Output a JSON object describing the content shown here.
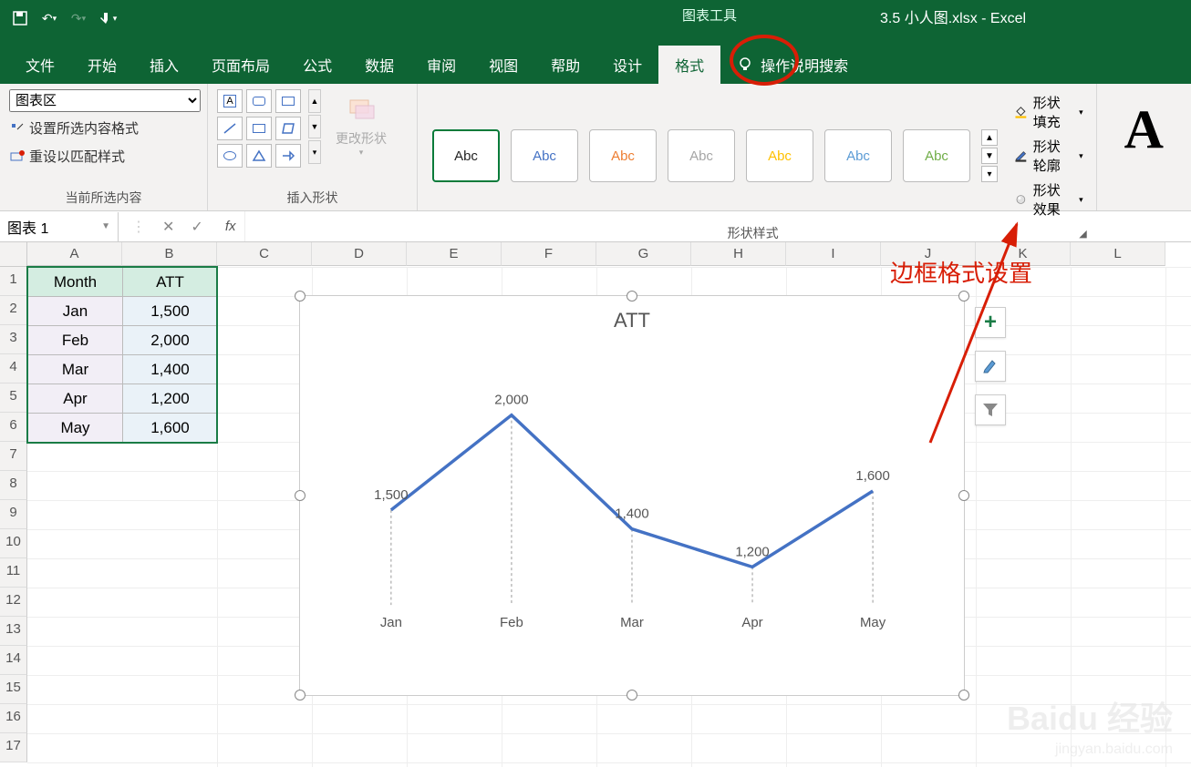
{
  "titlebar": {
    "chart_tools": "图表工具",
    "app_title": "3.5 小人图.xlsx  -  Excel"
  },
  "tabs": {
    "file": "文件",
    "home": "开始",
    "insert": "插入",
    "layout": "页面布局",
    "formulas": "公式",
    "data": "数据",
    "review": "审阅",
    "view": "视图",
    "help": "帮助",
    "design": "设计",
    "format": "格式",
    "tell_me": "操作说明搜索"
  },
  "ribbon": {
    "selection_group": {
      "dropdown": "图表区",
      "format_selection": "设置所选内容格式",
      "reset_style": "重设以匹配样式",
      "label": "当前所选内容"
    },
    "shapes_group": {
      "change_shape": "更改形状",
      "label": "插入形状"
    },
    "styles_group": {
      "abc": "Abc",
      "fill": "形状填充",
      "outline": "形状轮廓",
      "effects": "形状效果",
      "label": "形状样式"
    }
  },
  "formula_bar": {
    "name_box": "图表 1",
    "fx": "fx"
  },
  "columns": [
    "A",
    "B",
    "C",
    "D",
    "E",
    "F",
    "G",
    "H",
    "I",
    "J",
    "K",
    "L"
  ],
  "rows": [
    "1",
    "2",
    "3",
    "4",
    "5",
    "6",
    "7",
    "8",
    "9",
    "10",
    "11",
    "12",
    "13",
    "14",
    "15",
    "16",
    "17"
  ],
  "table": {
    "headers": [
      "Month",
      "ATT"
    ],
    "rows": [
      [
        "Jan",
        "1,500"
      ],
      [
        "Feb",
        "2,000"
      ],
      [
        "Mar",
        "1,400"
      ],
      [
        "Apr",
        "1,200"
      ],
      [
        "May",
        "1,600"
      ]
    ]
  },
  "chart_data": {
    "type": "line",
    "title": "ATT",
    "categories": [
      "Jan",
      "Feb",
      "Mar",
      "Apr",
      "May"
    ],
    "values": [
      1500,
      2000,
      1400,
      1200,
      1600
    ],
    "data_labels": [
      "1,500",
      "2,000",
      "1,400",
      "1,200",
      "1,600"
    ],
    "ylim": [
      1000,
      2100
    ]
  },
  "annotation": {
    "text": "边框格式设置"
  },
  "watermark": {
    "main": "Baidu 经验",
    "sub": "jingyan.baidu.com"
  }
}
